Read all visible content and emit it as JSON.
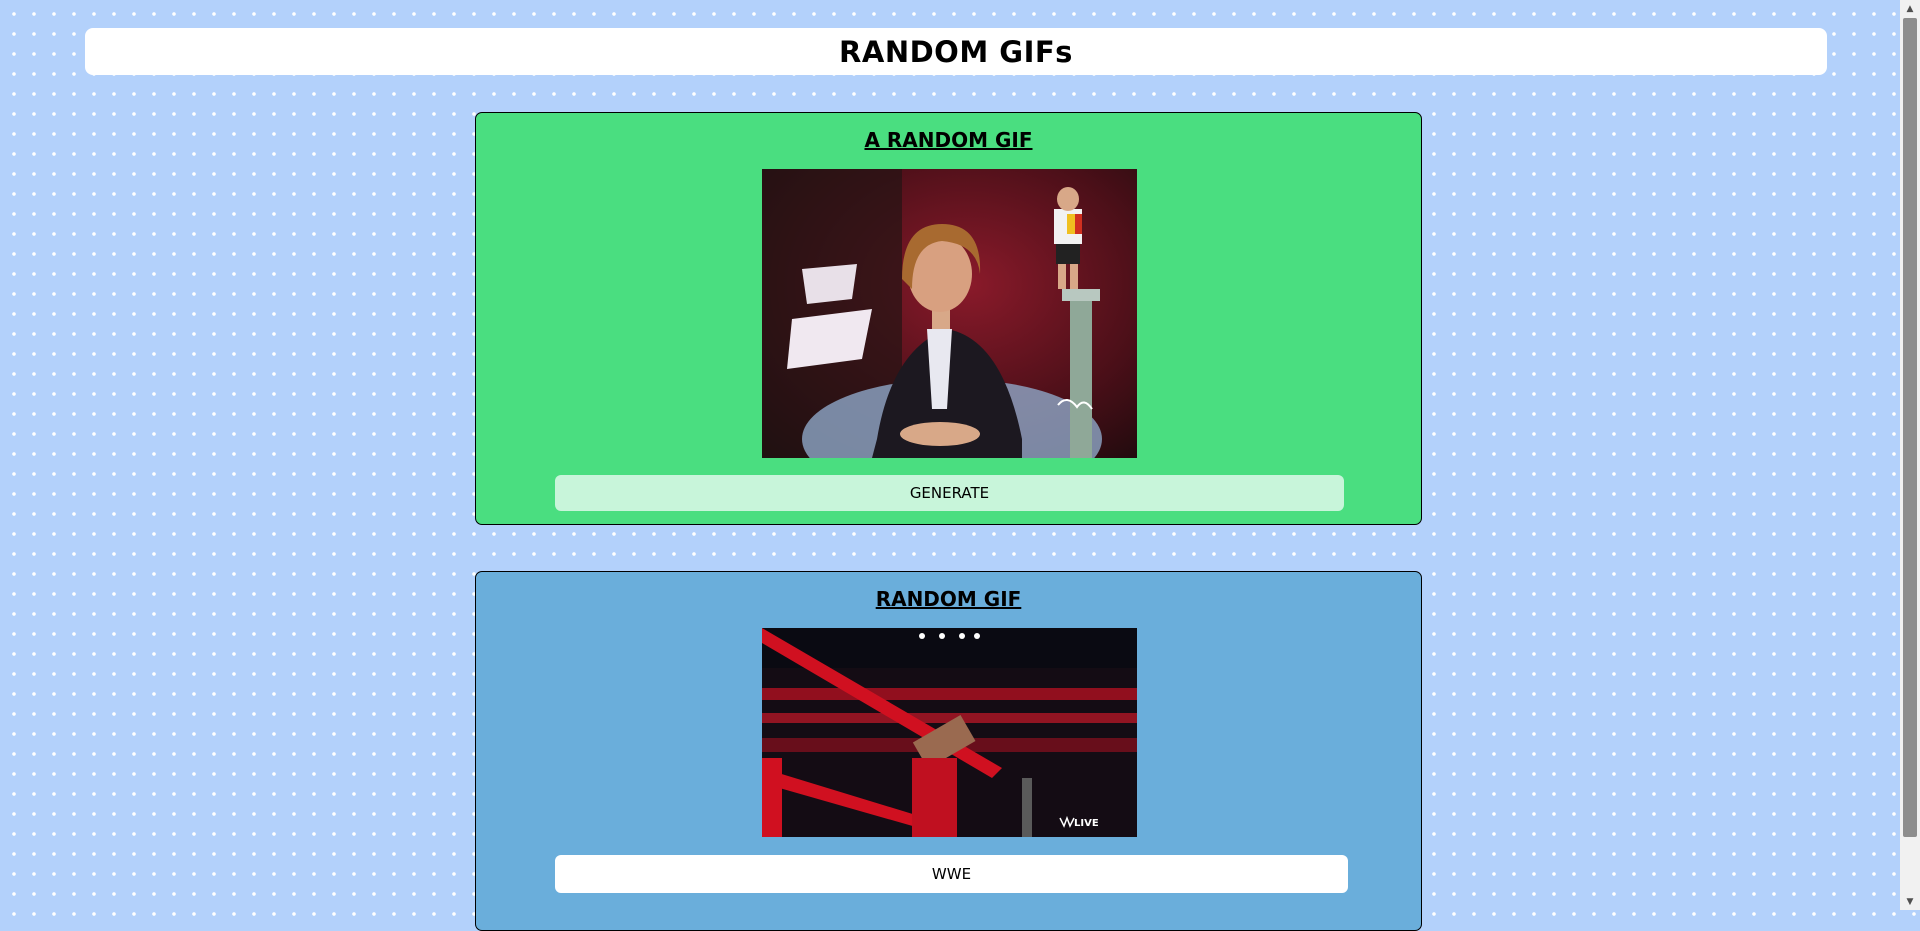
{
  "header": {
    "title": "RANDOM GIFs"
  },
  "random_card": {
    "title": "A RANDOM GIF",
    "button_label": "GENERATE",
    "bg_color": "#4ade80",
    "button_color": "#c8f5da"
  },
  "tag_card": {
    "title": "RANDOM GIF",
    "input_value": "WWE",
    "bg_color": "#6aaedb",
    "input_color": "#ffffff"
  },
  "colors": {
    "page_bg": "#b3d1fb",
    "dots": "#ffffff"
  }
}
